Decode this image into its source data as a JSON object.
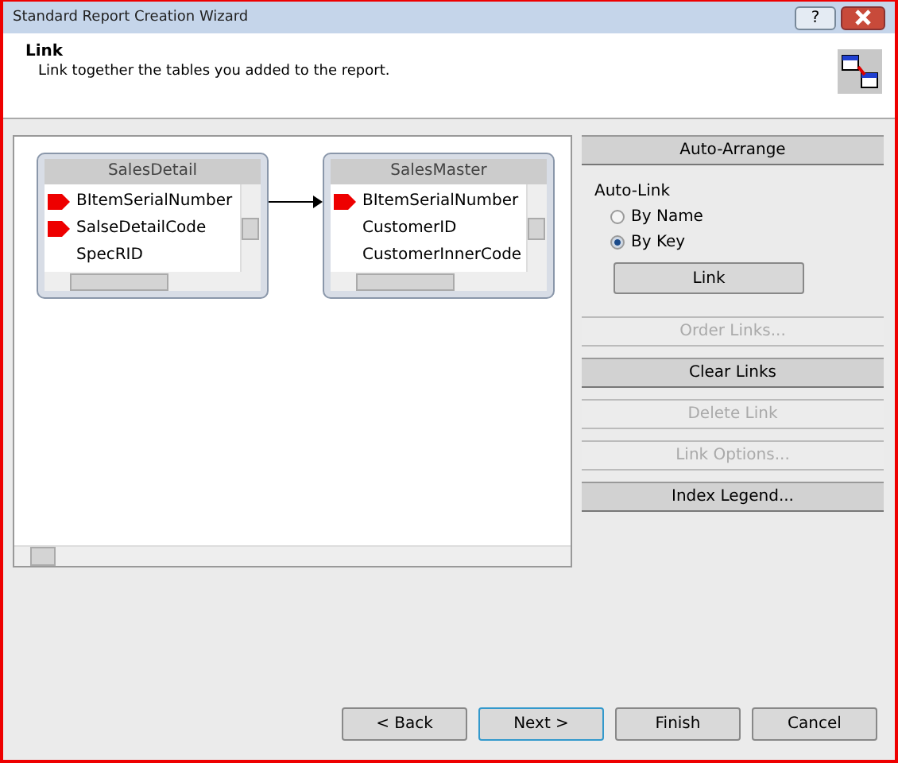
{
  "window": {
    "title": "Standard Report Creation Wizard",
    "help_button": "?"
  },
  "header": {
    "title": "Link",
    "subtitle": "Link together the tables you added to the report."
  },
  "tables": [
    {
      "name": "SalesDetail",
      "fields": [
        {
          "name": "BItemSerialNumber",
          "key": true
        },
        {
          "name": "SalseDetailCode",
          "key": true
        },
        {
          "name": "SpecRID",
          "key": false
        }
      ]
    },
    {
      "name": "SalesMaster",
      "fields": [
        {
          "name": "BItemSerialNumber",
          "key": true
        },
        {
          "name": "CustomerID",
          "key": false
        },
        {
          "name": "CustomerInnerCode",
          "key": false
        }
      ]
    }
  ],
  "actions_top": {
    "label": "Auto-Arrange",
    "disabled": false
  },
  "auto_link": {
    "label": "Auto-Link",
    "options": [
      {
        "label": "By Name",
        "selected": false
      },
      {
        "label": "By Key",
        "selected": true
      }
    ],
    "button": "Link"
  },
  "actions": [
    {
      "label": "Order Links...",
      "disabled": true
    },
    {
      "label": "Clear Links",
      "disabled": false
    },
    {
      "label": "Delete Link",
      "disabled": true
    },
    {
      "label": "Link Options...",
      "disabled": true
    },
    {
      "label": "Index Legend...",
      "disabled": false
    }
  ],
  "buttons": [
    {
      "label": "< Back",
      "default": false
    },
    {
      "label": "Next >",
      "default": true
    },
    {
      "label": "Finish",
      "default": false
    },
    {
      "label": "Cancel",
      "default": false
    }
  ]
}
